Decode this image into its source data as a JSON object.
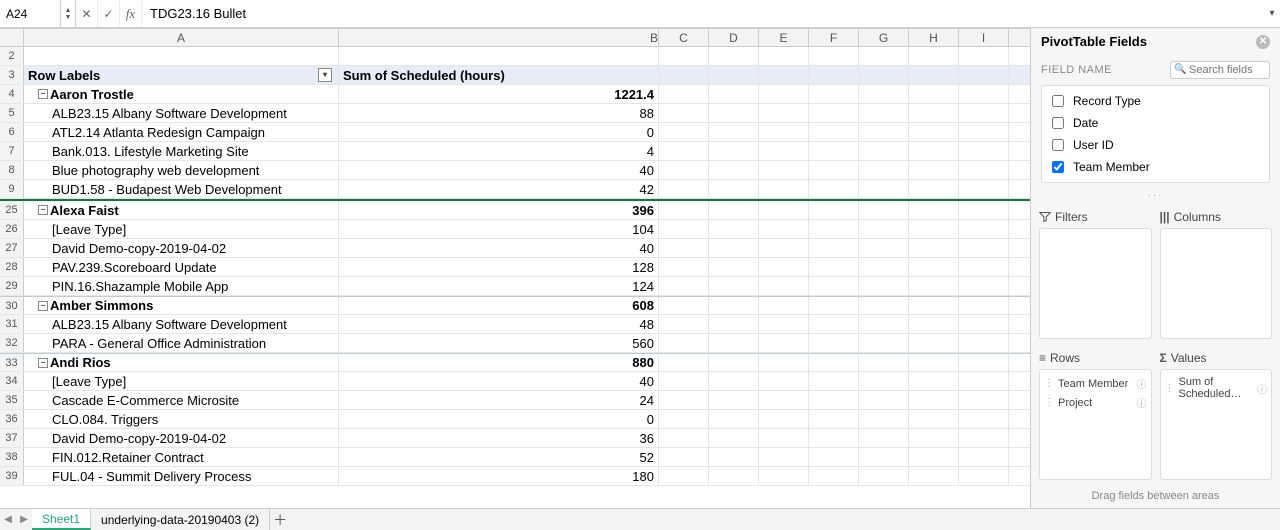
{
  "formula_bar": {
    "name_box": "A24",
    "formula": "TDG23.16 Bullet"
  },
  "columns": [
    "A",
    "B",
    "C",
    "D",
    "E",
    "F",
    "G",
    "H",
    "I"
  ],
  "header_row": {
    "num": "3",
    "a": "Row Labels",
    "b": "Sum of Scheduled (hours)"
  },
  "blank_row": {
    "num": "2"
  },
  "rows": [
    {
      "num": "4",
      "a": "Aaron Trostle",
      "b": "1221.4",
      "bold": true,
      "indent": 1,
      "collapse": true
    },
    {
      "num": "5",
      "a": "ALB23.15 Albany Software Development",
      "b": "88",
      "indent": 2
    },
    {
      "num": "6",
      "a": "ATL2.14 Atlanta Redesign Campaign",
      "b": "0",
      "indent": 2
    },
    {
      "num": "7",
      "a": "Bank.013. Lifestyle Marketing Site",
      "b": "4",
      "indent": 2
    },
    {
      "num": "8",
      "a": "Blue photography web development",
      "b": "40",
      "indent": 2
    },
    {
      "num": "9",
      "a": "BUD1.58 - Budapest Web Development",
      "b": "42",
      "indent": 2
    },
    {
      "num": "25",
      "a": "Alexa Faist",
      "b": "396",
      "bold": true,
      "indent": 1,
      "collapse": true,
      "split": true
    },
    {
      "num": "26",
      "a": "[Leave Type]",
      "b": "104",
      "indent": 2
    },
    {
      "num": "27",
      "a": "David Demo-copy-2019-04-02",
      "b": "40",
      "indent": 2
    },
    {
      "num": "28",
      "a": "PAV.239.Scoreboard Update",
      "b": "128",
      "indent": 2
    },
    {
      "num": "29",
      "a": "PIN.16.Shazample Mobile App",
      "b": "124",
      "indent": 2
    },
    {
      "num": "30",
      "a": "Amber Simmons",
      "b": "608",
      "bold": true,
      "indent": 1,
      "collapse": true,
      "gb": true
    },
    {
      "num": "31",
      "a": "ALB23.15 Albany Software Development",
      "b": "48",
      "indent": 2
    },
    {
      "num": "32",
      "a": "PARA - General Office Administration",
      "b": "560",
      "indent": 2
    },
    {
      "num": "33",
      "a": "Andi  Rios",
      "b": "880",
      "bold": true,
      "indent": 1,
      "collapse": true,
      "gb": true
    },
    {
      "num": "34",
      "a": "[Leave Type]",
      "b": "40",
      "indent": 2
    },
    {
      "num": "35",
      "a": "Cascade E-Commerce Microsite",
      "b": "24",
      "indent": 2
    },
    {
      "num": "36",
      "a": "CLO.084. Triggers",
      "b": "0",
      "indent": 2
    },
    {
      "num": "37",
      "a": "David Demo-copy-2019-04-02",
      "b": "36",
      "indent": 2
    },
    {
      "num": "38",
      "a": "FIN.012.Retainer Contract",
      "b": "52",
      "indent": 2
    },
    {
      "num": "39",
      "a": "FUL.04 - Summit Delivery Process",
      "b": "180",
      "indent": 2
    }
  ],
  "sheet_tabs": {
    "active": "Sheet1",
    "inactive": "underlying-data-20190403 (2)"
  },
  "pivot": {
    "title": "PivotTable Fields",
    "field_name_label": "FIELD NAME",
    "search_placeholder": "Search fields",
    "fields": [
      {
        "label": "Record Type",
        "checked": false
      },
      {
        "label": "Date",
        "checked": false
      },
      {
        "label": "User ID",
        "checked": false
      },
      {
        "label": "Team Member",
        "checked": true
      }
    ],
    "filters_label": "Filters",
    "columns_label": "Columns",
    "rows_label": "Rows",
    "values_label": "Values",
    "rows_pills": [
      "Team Member",
      "Project"
    ],
    "values_pills": [
      "Sum of Scheduled…"
    ],
    "footer": "Drag fields between areas"
  }
}
